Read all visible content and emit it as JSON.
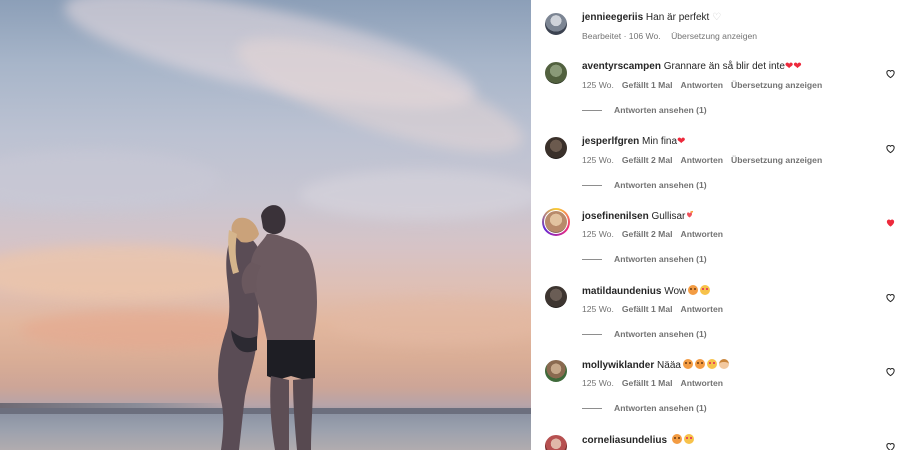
{
  "colors": {
    "text": "#262626",
    "secondary": "#737373",
    "like_red": "#ed2a3c"
  },
  "post": {
    "caption_user": "jennieegeriis",
    "caption_text": "Han är perfekt",
    "caption_meta": "Bearbeitet · 106 Wo.",
    "caption_translate": "Übersetzung anzeigen"
  },
  "comments": [
    {
      "user": "aventyrscampen",
      "text": "Grannare än så blir det inte",
      "emoji": [
        "heart",
        "heart"
      ],
      "age": "125 Wo.",
      "likes": "Gefällt 1 Mal",
      "reply": "Antworten",
      "translate": "Übersetzung anzeigen",
      "view_replies": "Antworten ansehen (1)",
      "liked": false
    },
    {
      "user": "jesperlfgren",
      "text": "Min fina",
      "emoji": [
        "heart"
      ],
      "age": "125 Wo.",
      "likes": "Gefällt 2 Mal",
      "reply": "Antworten",
      "translate": "Übersetzung anzeigen",
      "view_replies": "Antworten ansehen (1)",
      "liked": false
    },
    {
      "user": "josefinenilsen",
      "text": "Gullisar",
      "emoji": [
        "hearts"
      ],
      "age": "125 Wo.",
      "likes": "Gefällt 2 Mal",
      "reply": "Antworten",
      "translate": "",
      "view_replies": "Antworten ansehen (1)",
      "liked": true
    },
    {
      "user": "matildaundenius",
      "text": "Wow",
      "emoji": [
        "pouty",
        "love"
      ],
      "age": "125 Wo.",
      "likes": "Gefällt 1 Mal",
      "reply": "Antworten",
      "translate": "",
      "view_replies": "Antworten ansehen (1)",
      "liked": false
    },
    {
      "user": "mollywiklander",
      "text": "Nääa",
      "emoji": [
        "pouty",
        "pouty",
        "love",
        "baby"
      ],
      "age": "125 Wo.",
      "likes": "Gefällt 1 Mal",
      "reply": "Antworten",
      "translate": "",
      "view_replies": "Antworten ansehen (1)",
      "liked": false
    },
    {
      "user": "corneliasundelius",
      "text": "",
      "emoji": [
        "pouty",
        "love"
      ],
      "age": "",
      "likes": "",
      "reply": "",
      "translate": "",
      "view_replies": "",
      "liked": false
    }
  ],
  "icons": {
    "like": "heart-outline-icon",
    "liked": "heart-filled-icon"
  }
}
